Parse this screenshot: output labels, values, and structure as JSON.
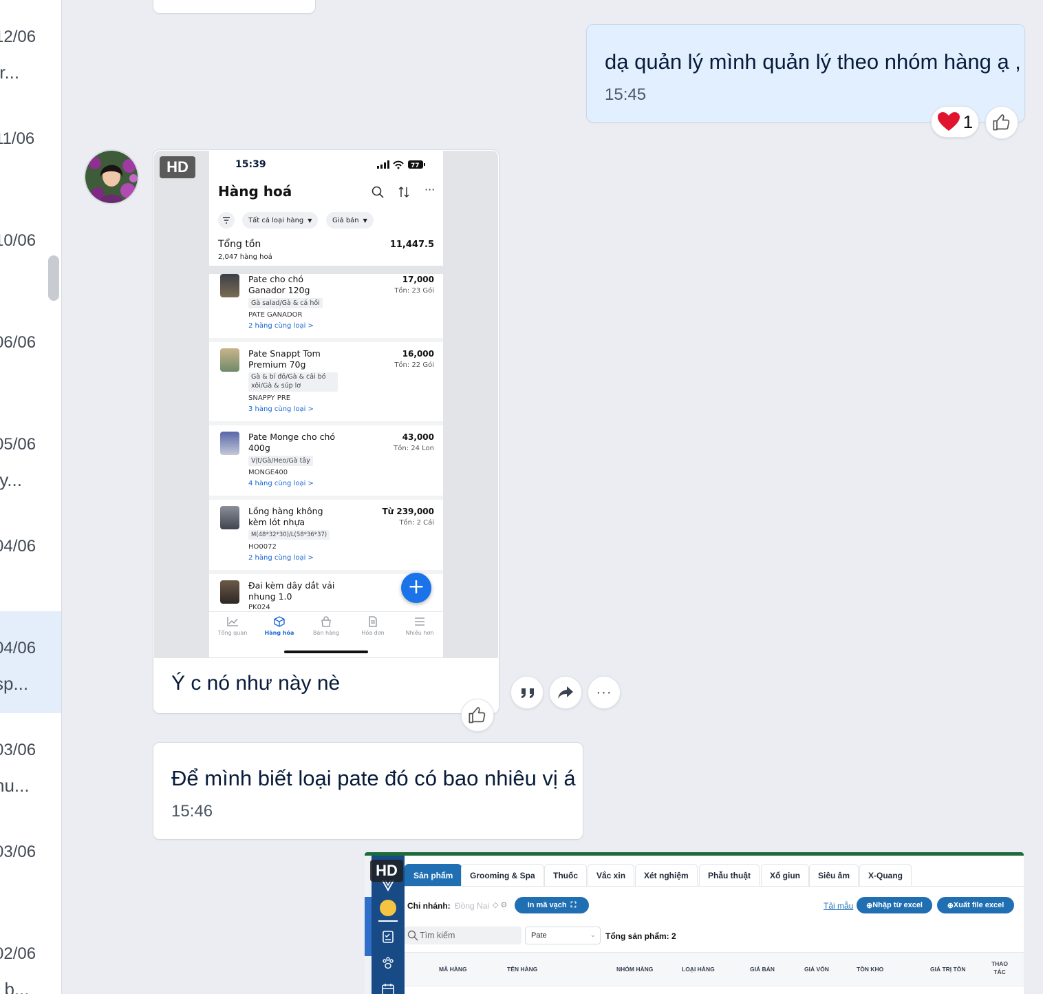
{
  "left_list": [
    {
      "date": "12/06",
      "snippet": "tr..."
    },
    {
      "date": "11/06",
      "snippet": ""
    },
    {
      "date": "10/06",
      "snippet": ""
    },
    {
      "date": "06/06",
      "snippet": ""
    },
    {
      "date": "05/06",
      "snippet": "/y..."
    },
    {
      "date": "04/06",
      "snippet": ""
    },
    {
      "date": "04/06",
      "snippet": "sp..."
    },
    {
      "date": "03/06",
      "snippet": "hu..."
    },
    {
      "date": "03/06",
      "snippet": ""
    },
    {
      "date": "02/06",
      "snippet": ": b..."
    }
  ],
  "msg1": {
    "text": "dạ quản lý mình quản lý theo nhóm hàng ạ ,",
    "time": "15:45",
    "reaction_count": "1"
  },
  "image_msg": {
    "hd": "HD",
    "caption": "Ý c nó như này nè"
  },
  "msg2": {
    "text": "Để mình biết loại pate đó có bao nhiêu vị á",
    "time": "15:46"
  },
  "phone": {
    "time": "15:39",
    "battery": "77",
    "title": "Hàng hoá",
    "filter_all": "Tất cả loại hàng",
    "filter_price": "Giá bán",
    "total_label": "Tổng tồn",
    "total_value": "11,447.5",
    "total_sub": "2,047 hàng hoá",
    "products": [
      {
        "name1": "Pate cho chó",
        "name2": "Ganador 120g",
        "price": "17,000",
        "stock": "Tồn: 23 Gói",
        "tag1": "Gà salad/Gà & cá hồi",
        "tag2": "",
        "code": "PATE GANADOR",
        "variants": "2 hàng cùng loại >"
      },
      {
        "name1": "Pate Snappt Tom",
        "name2": "Premium 70g",
        "price": "16,000",
        "stock": "Tồn: 22 Gói",
        "tag1": "Gà & bí đỏ/Gà & cải bó",
        "tag2": "xôi/Gà & súp lơ",
        "code": "SNAPPY PRE",
        "variants": "3 hàng cùng loại >"
      },
      {
        "name1": "Pate Monge cho chó",
        "name2": "400g",
        "price": "43,000",
        "stock": "Tồn: 24 Lon",
        "tag1": "Vịt/Gà/Heo/Gà tây",
        "tag2": "",
        "code": "MONGE400",
        "variants": "4 hàng cùng loại >"
      },
      {
        "name1": "Lồng hàng không",
        "name2": "kèm lót nhựa",
        "price": "Từ 239,000",
        "stock": "Tồn: 2 Cái",
        "tag1": "M(48*32*30)/L(58*36*37)",
        "tag2": "",
        "code": "HO0072",
        "variants": "2 hàng cùng loại >"
      },
      {
        "name1": "Đai kèm dây dắt vải",
        "name2": "nhung 1.0",
        "price": "",
        "stock": "",
        "tag1": "",
        "tag2": "",
        "code": "PK024",
        "variants": ""
      }
    ],
    "nav": [
      "Tổng quan",
      "Hàng hóa",
      "Bán hàng",
      "Hóa đơn",
      "Nhiều hơn"
    ]
  },
  "web": {
    "hd": "HD",
    "tabs": [
      "Sản phẩm",
      "Grooming & Spa",
      "Thuốc",
      "Vắc xin",
      "Xét nghiệm",
      "Phẫu thuật",
      "Xổ giun",
      "Siêu âm",
      "X-Quang"
    ],
    "branch_label": "Chi nhánh:",
    "branch_value": "Đồng Nai",
    "print_btn": "In mã vạch",
    "sample_link": "Tải mẫu",
    "import_btn": "Nhập từ excel",
    "export_btn": "Xuất file excel",
    "search_placeholder": "Tìm kiếm",
    "group_select": "Pate",
    "total_products": "Tổng sản phẩm: 2",
    "columns": [
      "MÃ HÀNG",
      "TÊN HÀNG",
      "NHÓM HÀNG",
      "LOẠI HÀNG",
      "GIÁ BÁN",
      "GIÁ VỐN",
      "TỒN KHO",
      "GIÁ TRỊ TỒN",
      "THAO TÁC"
    ]
  },
  "colors": {
    "accent": "#1f6fb2",
    "fab": "#1a73e8",
    "my_bubble": "#e2effe",
    "green_header": "#1d6b3a"
  }
}
